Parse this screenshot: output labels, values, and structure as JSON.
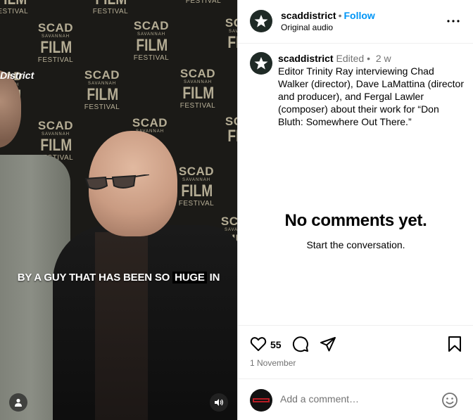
{
  "media": {
    "logo_lines": [
      "SCAD",
      "SAVANNAH",
      "FILM",
      "FESTIVAL"
    ],
    "brand_overlay": "District",
    "subtitle_text": "BY A GUY THAT HAS BEEN SO",
    "subtitle_highlight": "HUGE",
    "subtitle_end": "IN",
    "icons": [
      "profile-icon",
      "volume-icon"
    ]
  },
  "header": {
    "username": "scaddistrict",
    "dot": "•",
    "follow_label": "Follow",
    "subtitle": "Original audio"
  },
  "caption": {
    "username": "scaddistrict",
    "edited": "Edited",
    "dot": "•",
    "age": "2 w",
    "text": "Editor Trinity Ray interviewing Chad Walker (director), Dave LaMattina (director and producer), and Fergal Lawler (composer) about their work for “Don Bluth: Somewhere Out There.”"
  },
  "empty_state": {
    "title": "No comments yet.",
    "subtitle": "Start the conversation."
  },
  "actions": {
    "like_count": "55",
    "date": "1 November"
  },
  "comment": {
    "placeholder": "Add a comment…"
  },
  "colors": {
    "follow": "#0095f6",
    "muted": "#737373",
    "backdrop_text": "#cfc6aa"
  }
}
